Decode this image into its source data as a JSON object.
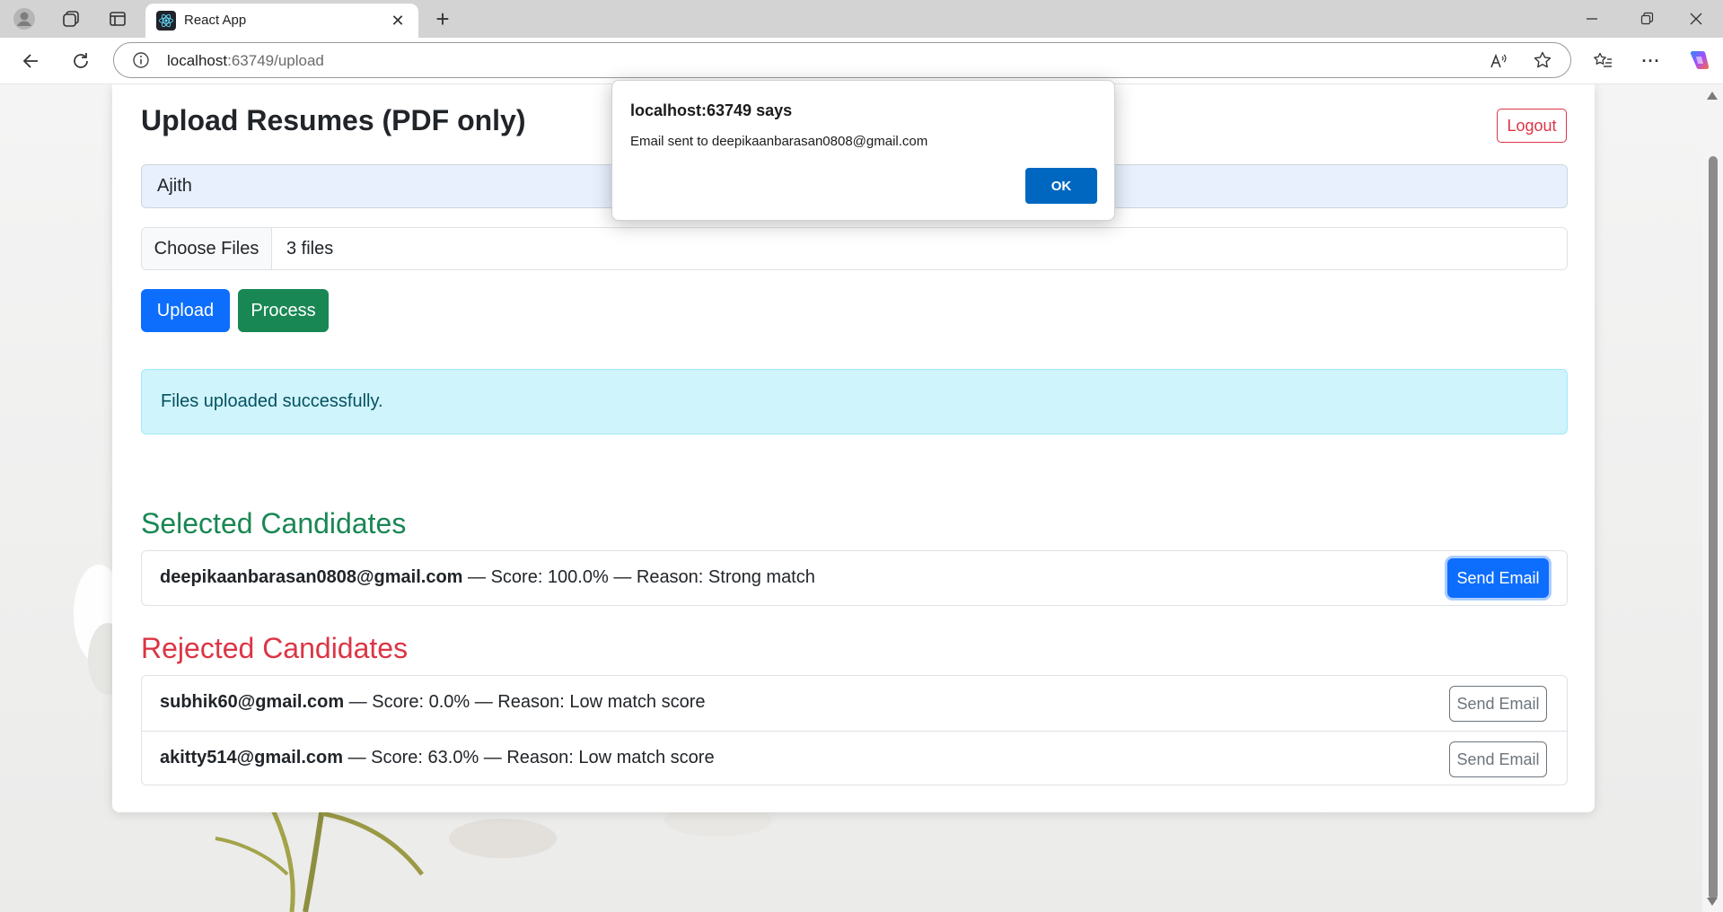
{
  "browser": {
    "tab_title": "React App",
    "url_host": "localhost",
    "url_path": ":63749/upload",
    "tab_close_glyph": "✕",
    "new_tab_glyph": "+",
    "more_glyph": "···"
  },
  "page": {
    "title": "Upload Resumes (PDF only)",
    "logout_label": "Logout",
    "name_value": "Ajith",
    "file_button_label": "Choose Files",
    "file_count": "3 files",
    "upload_label": "Upload",
    "process_label": "Process",
    "alert_text": "Files uploaded successfully."
  },
  "selected": {
    "heading": "Selected Candidates",
    "items": [
      {
        "email": "deepikaanbarasan0808@gmail.com",
        "details": " — Score: 100.0% — Reason: Strong match",
        "button": "Send Email"
      }
    ]
  },
  "rejected": {
    "heading": "Rejected Candidates",
    "items": [
      {
        "email": "subhik60@gmail.com",
        "details": " — Score: 0.0% — Reason: Low match score",
        "button": "Send Email"
      },
      {
        "email": "akitty514@gmail.com",
        "details": " — Score: 63.0% — Reason: Low match score",
        "button": "Send Email"
      }
    ]
  },
  "dialog": {
    "title": "localhost:63749 says",
    "message": "Email sent to deepikaanbarasan0808@gmail.com",
    "ok_label": "OK"
  },
  "colors": {
    "primary": "#0d6efd",
    "success": "#198754",
    "danger": "#dc3545",
    "info_bg": "#cff4fc",
    "dialog_ok": "#0067c0"
  },
  "icons": [
    "profile-icon",
    "workspaces-icon",
    "tab-actions-icon",
    "react-favicon-icon",
    "back-icon",
    "refresh-icon",
    "info-icon",
    "read-aloud-icon",
    "favorite-star-icon",
    "favorites-icon",
    "copilot-icon",
    "minimize-icon",
    "restore-icon",
    "close-window-icon"
  ]
}
